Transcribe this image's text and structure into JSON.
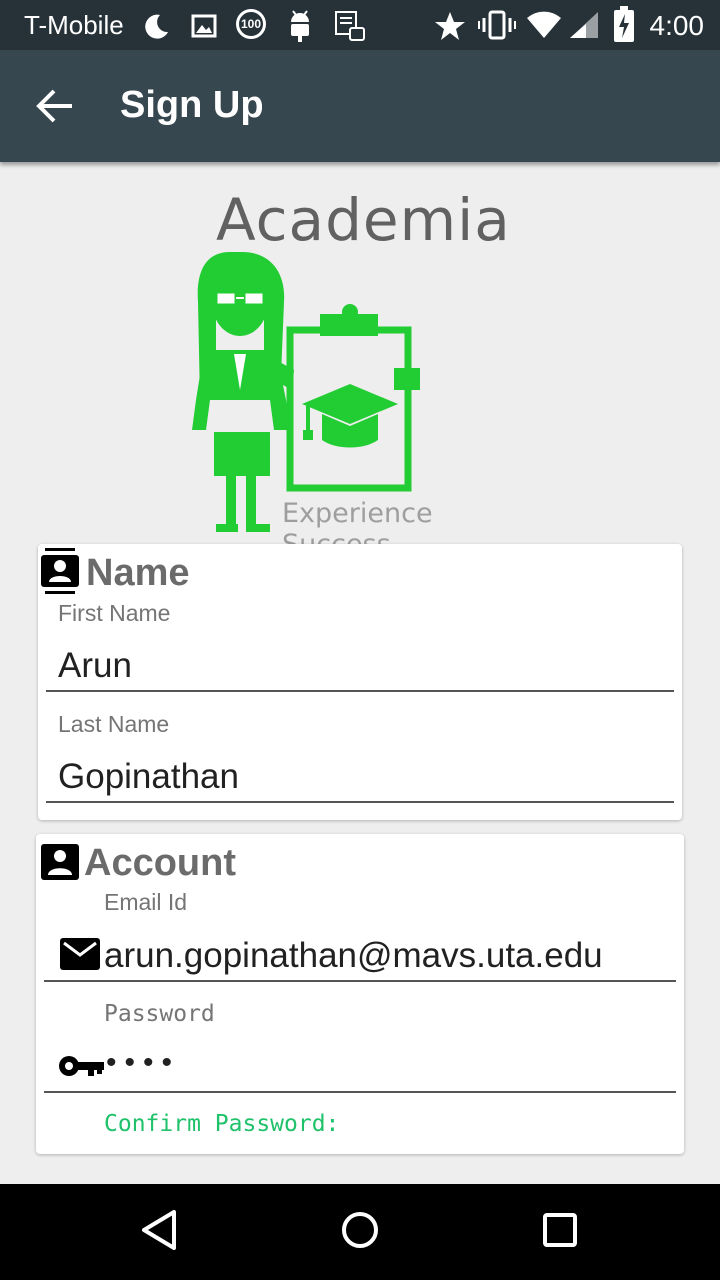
{
  "status_bar": {
    "carrier": "T-Mobile",
    "time": "4:00",
    "badge": "100"
  },
  "app_bar": {
    "title": "Sign Up"
  },
  "logo": {
    "brand": "Academia",
    "tagline": "Experience Success",
    "accent_color": "#22cc33"
  },
  "name_section": {
    "title": "Name",
    "first_name": {
      "label": "First Name",
      "value": "Arun"
    },
    "last_name": {
      "label": "Last Name",
      "value": "Gopinathan"
    }
  },
  "account_section": {
    "title": "Account",
    "email": {
      "label": "Email Id",
      "value": "arun.gopinathan@mavs.uta.edu"
    },
    "password": {
      "label": "Password",
      "value": "••••"
    },
    "confirm_password": {
      "label": "Confirm Password:"
    }
  },
  "colors": {
    "status_bar": "#263238",
    "app_bar": "#37474f",
    "focus_label": "#1fc26a"
  }
}
